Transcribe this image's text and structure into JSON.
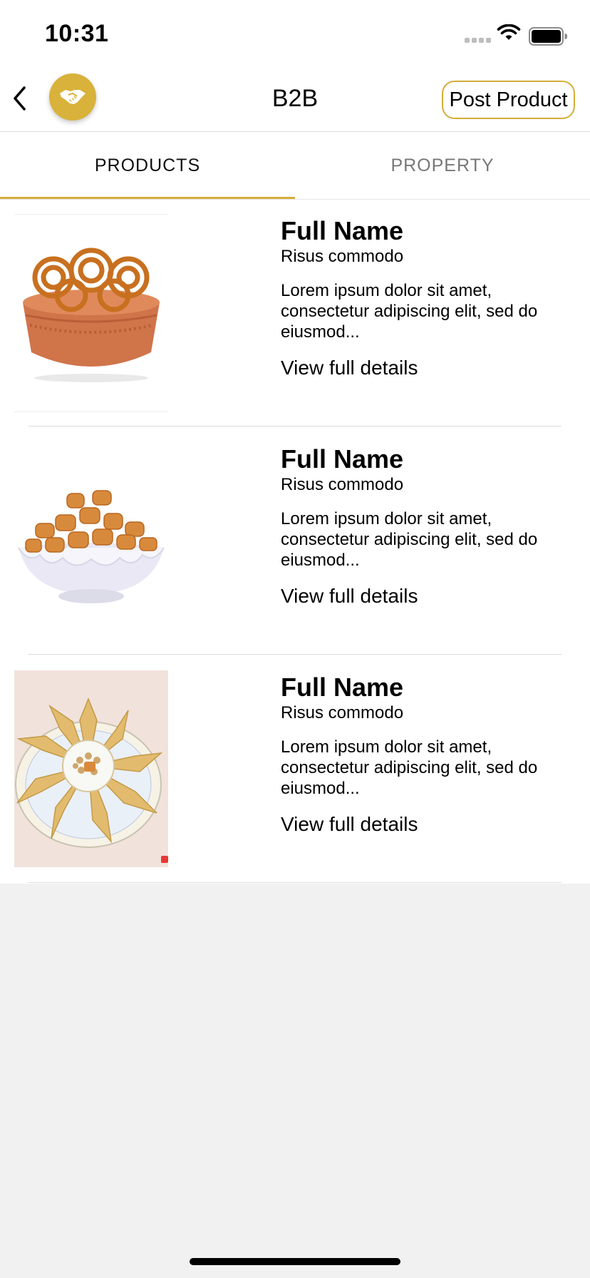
{
  "status_bar": {
    "time": "10:31"
  },
  "header": {
    "title": "B2B",
    "post_button_label": "Post Product"
  },
  "tabs": [
    {
      "label": "PRODUCTS",
      "active": true
    },
    {
      "label": "PROPERTY",
      "active": false
    }
  ],
  "products": [
    {
      "name": "Full Name",
      "subtitle": "Risus commodo",
      "description": "Lorem ipsum dolor sit amet, consectetur adipiscing elit, sed do eiusmod...",
      "link": "View full details",
      "image": "chakli-in-clay-pot"
    },
    {
      "name": "Full Name",
      "subtitle": "Risus commodo",
      "description": "Lorem ipsum dolor sit amet, consectetur adipiscing elit, sed do eiusmod...",
      "link": "View full details",
      "image": "shakarpara-in-white-bowl"
    },
    {
      "name": "Full Name",
      "subtitle": "Risus commodo",
      "description": "Lorem ipsum dolor sit amet, consectetur adipiscing elit, sed do eiusmod...",
      "link": "View full details",
      "image": "gujiya-on-plate"
    }
  ],
  "colors": {
    "accent": "#d4ad3a",
    "logo": "#d8b23a",
    "background": "#f1f1f1"
  },
  "icons": {
    "back": "chevron-left-icon",
    "logo": "handshake-icon",
    "wifi": "wifi-icon",
    "battery": "battery-icon"
  }
}
